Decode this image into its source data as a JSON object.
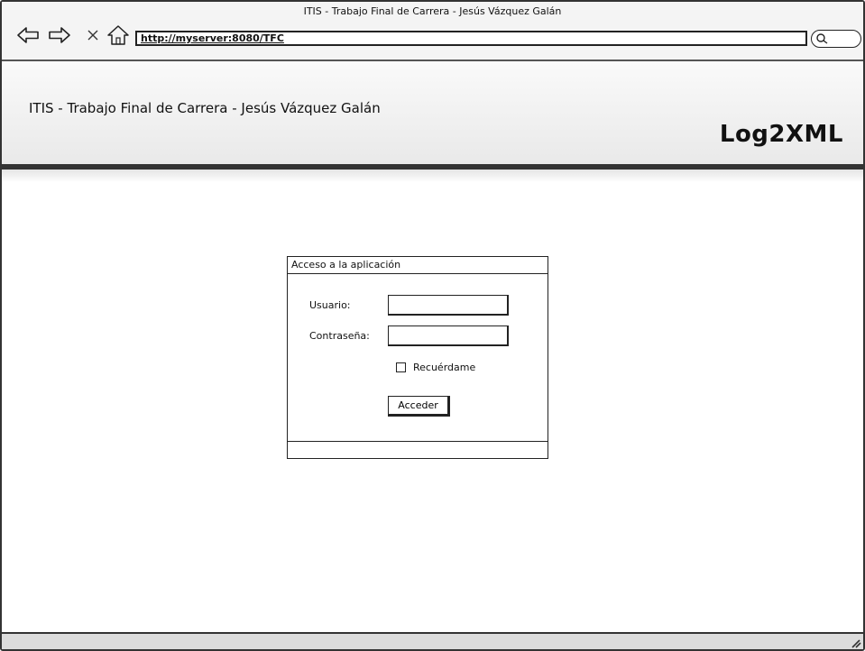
{
  "browser": {
    "window_title": "ITIS - Trabajo Final de Carrera -  Jesús Vázquez Galán",
    "url": "http://myserver:8080/TFC",
    "nav_icons": [
      "back-arrow-icon",
      "forward-arrow-icon",
      "close-x-icon",
      "home-icon"
    ],
    "search_icon": "search-icon"
  },
  "header": {
    "title": "ITIS - Trabajo Final de Carrera - Jesús Vázquez Galán",
    "logo": "Log2XML"
  },
  "login": {
    "panel_title": "Acceso a la aplicación",
    "username_label": "Usuario:",
    "username_value": "",
    "password_label": "Contraseña:",
    "password_value": "",
    "remember_label": "Recuérdame",
    "remember_checked": false,
    "submit_label": "Acceder"
  },
  "colors": {
    "border": "#222222",
    "header_rule": "#333333",
    "status_bar": "#dcdcdc"
  }
}
